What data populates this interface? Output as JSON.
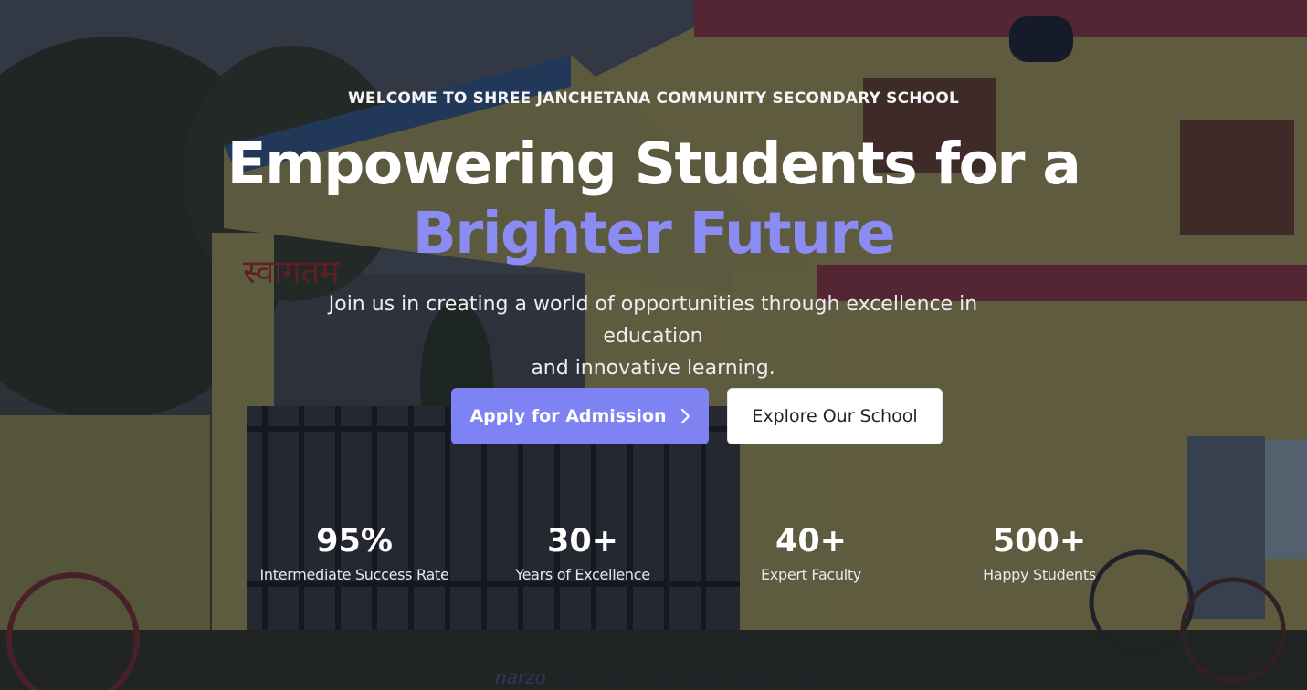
{
  "hero": {
    "eyebrow": "WELCOME TO SHREE JANCHETANA COMMUNITY SECONDARY SCHOOL",
    "title_line1": "Empowering Students for a",
    "title_accent": "Brighter Future",
    "subtitle_line1": "Join us in creating a world of opportunities through excellence in education",
    "subtitle_line2": "and innovative learning.",
    "accent_color": "#8a8cf4"
  },
  "buttons": {
    "primary_label": "Apply for Admission",
    "primary_icon": "chevron-right-icon",
    "secondary_label": "Explore Our School"
  },
  "stats": [
    {
      "value": "95%",
      "label": "Intermediate Success Rate"
    },
    {
      "value": "30+",
      "label": "Years of Excellence"
    },
    {
      "value": "40+",
      "label": "Expert Faculty"
    },
    {
      "value": "500+",
      "label": "Happy Students"
    }
  ],
  "photo": {
    "gate_text_vertical": "स्वागतम",
    "watermark_brand": "narzo",
    "watermark_text": "Shot by Dharmpal chaudhary"
  }
}
